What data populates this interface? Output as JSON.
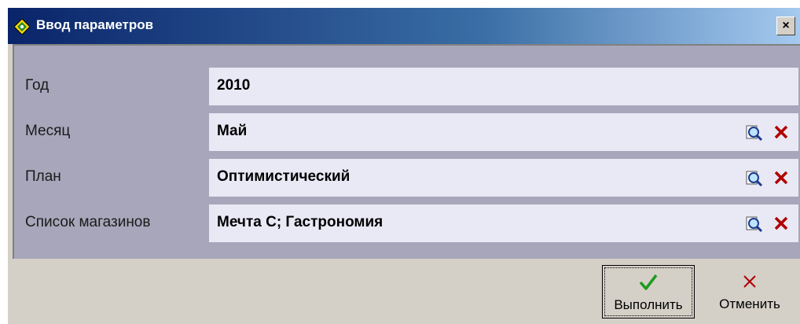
{
  "window": {
    "title": "Ввод параметров",
    "close_glyph": "×"
  },
  "fields": [
    {
      "label": "Год",
      "value": "2010",
      "has_actions": false
    },
    {
      "label": "Месяц",
      "value": "Май",
      "has_actions": true
    },
    {
      "label": "План",
      "value": "Оптимистический",
      "has_actions": true
    },
    {
      "label": "Список магазинов",
      "value": "Мечта С; Гастрономия",
      "has_actions": true
    }
  ],
  "buttons": {
    "run_label": "Выполнить",
    "cancel_label": "Отменить"
  },
  "icons": {
    "lookup": "lookup-magnifier-icon",
    "clear": "clear-x-icon",
    "run": "checkmark-icon",
    "cancel": "cancel-x-icon"
  },
  "colors": {
    "panel_bg": "#a7a6ba",
    "field_bg": "#e9e8f5",
    "clear_red": "#b00000",
    "check_green": "#1e9a1e",
    "title_start": "#0a246a"
  }
}
